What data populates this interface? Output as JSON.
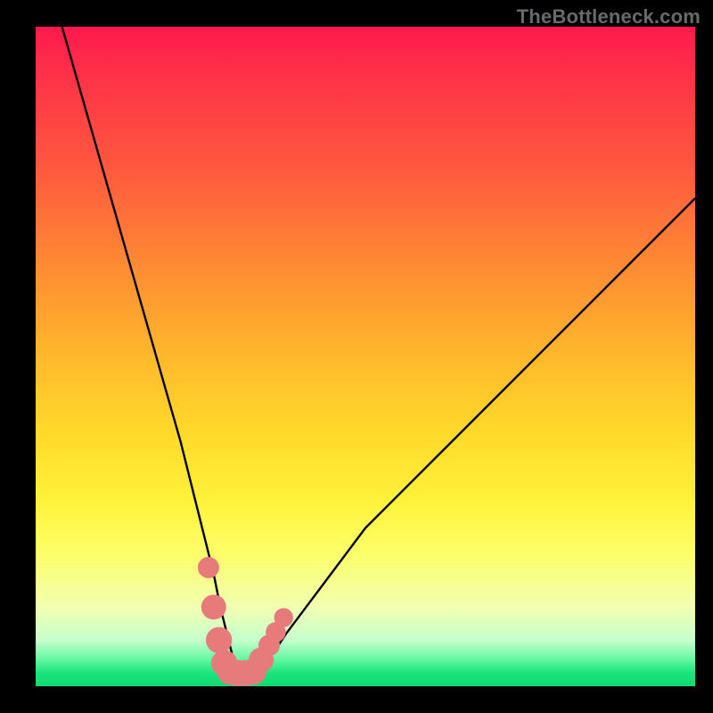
{
  "watermark": "TheBottleneck.com",
  "chart_data": {
    "type": "line",
    "title": "",
    "xlabel": "",
    "ylabel": "",
    "xlim": [
      0,
      100
    ],
    "ylim": [
      0,
      100
    ],
    "grid": false,
    "series": [
      {
        "name": "bottleneck-curve",
        "x": [
          4,
          6,
          8,
          10,
          12,
          14,
          16,
          18,
          20,
          22,
          24,
          26,
          27,
          28,
          29,
          30,
          31,
          32,
          34,
          36,
          38,
          41,
          44,
          47,
          50,
          54,
          58,
          62,
          67,
          72,
          78,
          84,
          90,
          96,
          100
        ],
        "values": [
          100,
          93,
          86,
          79,
          72,
          65,
          58,
          51,
          44,
          37,
          29,
          21,
          17,
          12,
          8,
          4,
          2,
          2,
          3,
          5,
          8,
          12,
          16,
          20,
          24,
          28,
          32,
          36,
          41,
          46,
          52,
          58,
          64,
          70,
          74
        ]
      }
    ],
    "markers": [
      {
        "name": "left-cluster-1",
        "x": 26.2,
        "y": 18.0,
        "r": 1.2
      },
      {
        "name": "left-cluster-2",
        "x": 27.0,
        "y": 12.0,
        "r": 1.5
      },
      {
        "name": "left-cluster-3",
        "x": 27.8,
        "y": 7.0,
        "r": 1.6
      },
      {
        "name": "left-cluster-4",
        "x": 28.6,
        "y": 3.5,
        "r": 1.6
      },
      {
        "name": "bottom-1",
        "x": 29.5,
        "y": 2.2,
        "r": 1.6
      },
      {
        "name": "bottom-2",
        "x": 30.6,
        "y": 2.0,
        "r": 1.6
      },
      {
        "name": "bottom-3",
        "x": 31.8,
        "y": 2.0,
        "r": 1.6
      },
      {
        "name": "bottom-4",
        "x": 33.0,
        "y": 2.2,
        "r": 1.6
      },
      {
        "name": "right-cluster-1",
        "x": 34.2,
        "y": 4.0,
        "r": 1.5
      },
      {
        "name": "right-cluster-2",
        "x": 35.4,
        "y": 6.2,
        "r": 1.2
      },
      {
        "name": "right-cluster-3",
        "x": 36.4,
        "y": 8.2,
        "r": 1.1
      },
      {
        "name": "right-cluster-4",
        "x": 37.6,
        "y": 10.4,
        "r": 1.0
      }
    ],
    "marker_color": "#e77b7b",
    "curve_color": "#000000"
  }
}
